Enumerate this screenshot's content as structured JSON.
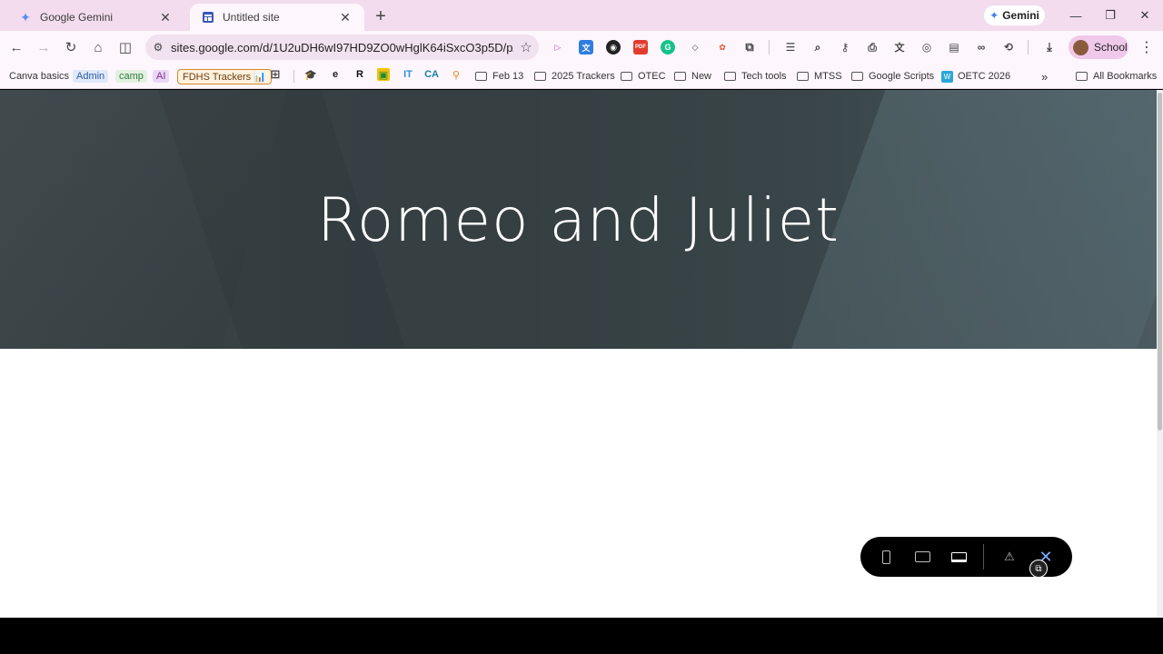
{
  "tabs": [
    {
      "title": "Google Gemini",
      "favicon": "gemini-star-icon",
      "active": false
    },
    {
      "title": "Untitled site",
      "favicon": "google-sites-icon",
      "active": true
    }
  ],
  "gemini_button": {
    "label": "Gemini"
  },
  "address_bar": {
    "url": "sites.google.com/d/1U2uDH6wI97HD9ZO0wHglK64iSxcO3p5D/p/12i..."
  },
  "profile": {
    "label": "School"
  },
  "bookmarks": {
    "canva": "Canva basics",
    "admin": "Admin",
    "camp": "camp",
    "ai": "AI",
    "fdhs": "FDHS Trackers 📊",
    "feb13": "Feb 13",
    "trackers2025": "2025 Trackers",
    "otec": "OTEC",
    "new": "New",
    "techtools": "Tech tools",
    "mtss": "MTSS",
    "scripts": "Google Scripts",
    "oetc": "OETC 2026",
    "overflow": "»",
    "all": "All Bookmarks"
  },
  "page": {
    "hero_title": "Romeo and Juliet"
  },
  "colors": {
    "tabstrip": "#f2dcee",
    "toolbar": "#fdf6fc",
    "hero": "#3a4447",
    "preview_close": "#7fb0ff"
  }
}
